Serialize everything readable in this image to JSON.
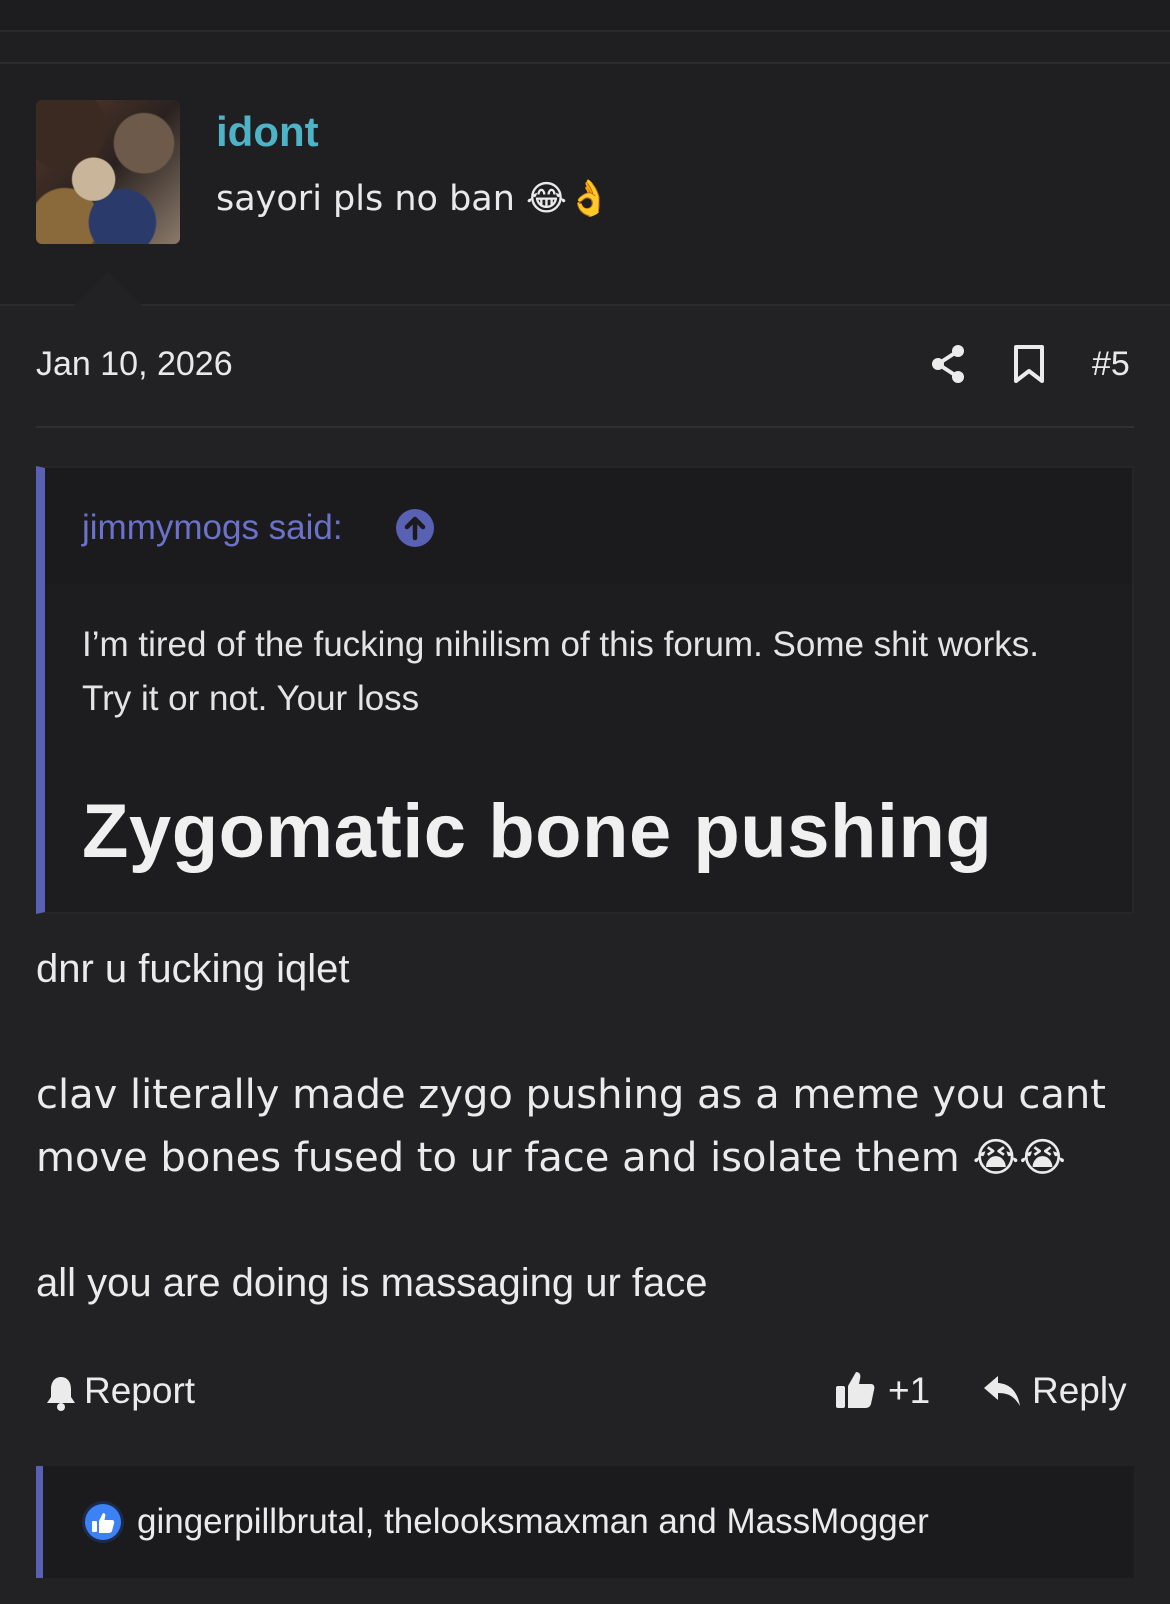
{
  "post": {
    "author": "idont",
    "author_title": "sayori pls no ban 😂👌",
    "date": "Jan 10, 2026",
    "post_number": "#5",
    "share_icon": "share-icon",
    "bookmark_icon": "bookmark-icon"
  },
  "quote": {
    "author_line": "jimmymogs said:",
    "text": "I’m tired of the fucking nihilism of this forum. Some shit works. Try it or not. Your loss",
    "heading": "Zygomatic bone pushing"
  },
  "body": {
    "p1": "dnr u fucking iqlet",
    "p2": "clav literally made zygo pushing as a meme you cant move bones fused to ur face and isolate them 😭😭",
    "p3": "all you are doing is massaging ur face"
  },
  "actions": {
    "report": "Report",
    "like_count": "+1",
    "reply": "Reply"
  },
  "reactions": {
    "users": "gingerpillbrutal, thelooksmaxman and MassMogger"
  },
  "colors": {
    "background": "#222224",
    "username": "#4fb3c8",
    "quote_accent": "#5961b5",
    "like_blue": "#3b82f6"
  }
}
